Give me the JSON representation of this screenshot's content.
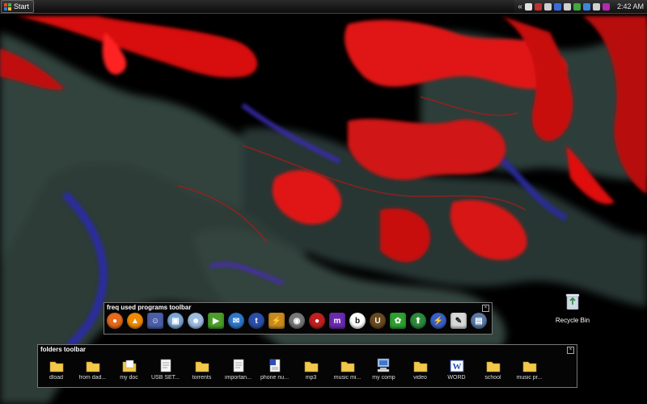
{
  "taskbar": {
    "start_label": "Start",
    "tray_chevron": "«",
    "clock": "2:42 AM",
    "tray_icons": [
      {
        "name": "network-icon",
        "color": "#e0e0e0"
      },
      {
        "name": "network-alert-icon",
        "color": "#c03030"
      },
      {
        "name": "volume-icon",
        "color": "#cfcfcf"
      },
      {
        "name": "phone-icon",
        "color": "#3a6bd8"
      },
      {
        "name": "usb-icon",
        "color": "#d0d0d0"
      },
      {
        "name": "messenger-icon",
        "color": "#3fa83f"
      },
      {
        "name": "sync-icon",
        "color": "#3b86e0"
      },
      {
        "name": "shield-icon",
        "color": "#d0d0d0"
      },
      {
        "name": "media-icon",
        "color": "#b02cb0"
      }
    ]
  },
  "desktop": {
    "recycle_bin_label": "Recycle Bin"
  },
  "freq_toolbar": {
    "title": "freq used programs toolbar",
    "programs": [
      {
        "name": "firefox-icon",
        "bg": "#e46a1c",
        "glyph": "●"
      },
      {
        "name": "vlc-icon",
        "bg": "#f08a00",
        "glyph": "▲"
      },
      {
        "name": "people-icon",
        "bg": "#4a5fa8",
        "glyph": "☺"
      },
      {
        "name": "network-computers-icon",
        "bg": "#7aa7d8",
        "glyph": "▣"
      },
      {
        "name": "messenger-buddy-icon",
        "bg": "#9dbbe0",
        "glyph": "☻"
      },
      {
        "name": "media-player-icon",
        "bg": "#4b9e2a",
        "glyph": "▶"
      },
      {
        "name": "outlook-icon",
        "bg": "#2d77c8",
        "glyph": "✉"
      },
      {
        "name": "info-icon",
        "bg": "#2b4fa8",
        "glyph": "t"
      },
      {
        "name": "winamp-icon",
        "bg": "#c88a20",
        "glyph": "⚡"
      },
      {
        "name": "speaker-icon",
        "bg": "#777777",
        "glyph": "◉"
      },
      {
        "name": "record-icon",
        "bg": "#c02020",
        "glyph": "●"
      },
      {
        "name": "me-icon",
        "bg": "#6a2ab0",
        "glyph": "m"
      },
      {
        "name": "b-icon",
        "bg": "#ffffff",
        "glyph": "b"
      },
      {
        "name": "unreal-icon",
        "bg": "#6a4a20",
        "glyph": "U"
      },
      {
        "name": "limewire-icon",
        "bg": "#2ea030",
        "glyph": "✿"
      },
      {
        "name": "upload-icon",
        "bg": "#2a8a3a",
        "glyph": "⬆"
      },
      {
        "name": "lightning-icon",
        "bg": "#3a5fc8",
        "glyph": "⚡"
      },
      {
        "name": "paint-icon",
        "bg": "#d8d8d8",
        "glyph": "✎"
      },
      {
        "name": "settings-window-icon",
        "bg": "#5a7aa8",
        "glyph": "▤"
      }
    ]
  },
  "folders_toolbar": {
    "title": "folders toolbar",
    "items": [
      {
        "name": "folder-dload",
        "label": "dload",
        "type": "folder"
      },
      {
        "name": "folder-from-dad",
        "label": "from dad...",
        "type": "folder"
      },
      {
        "name": "folder-my-doc",
        "label": "my doc",
        "type": "folder-doc"
      },
      {
        "name": "file-usb-setup",
        "label": "USB SET...",
        "type": "file"
      },
      {
        "name": "folder-torrents",
        "label": "torrents",
        "type": "folder"
      },
      {
        "name": "file-important",
        "label": "importan...",
        "type": "file"
      },
      {
        "name": "file-phone-numbers",
        "label": "phone nu...",
        "type": "word-file"
      },
      {
        "name": "folder-mp3",
        "label": "mp3",
        "type": "folder"
      },
      {
        "name": "folder-music-mix",
        "label": "music mi...",
        "type": "folder"
      },
      {
        "name": "my-computer",
        "label": "my comp",
        "type": "computer"
      },
      {
        "name": "folder-video",
        "label": "video",
        "type": "folder"
      },
      {
        "name": "word-shortcut",
        "label": "WORD",
        "type": "word"
      },
      {
        "name": "folder-school",
        "label": "school",
        "type": "folder"
      },
      {
        "name": "folder-music-pr",
        "label": "music pr...",
        "type": "folder"
      }
    ]
  },
  "colors": {
    "wallpaper_red": "#e01010",
    "wallpaper_teal": "#3c5a52",
    "wallpaper_blue": "#2a2aa0",
    "folder_yellow": "#f2c84a"
  }
}
